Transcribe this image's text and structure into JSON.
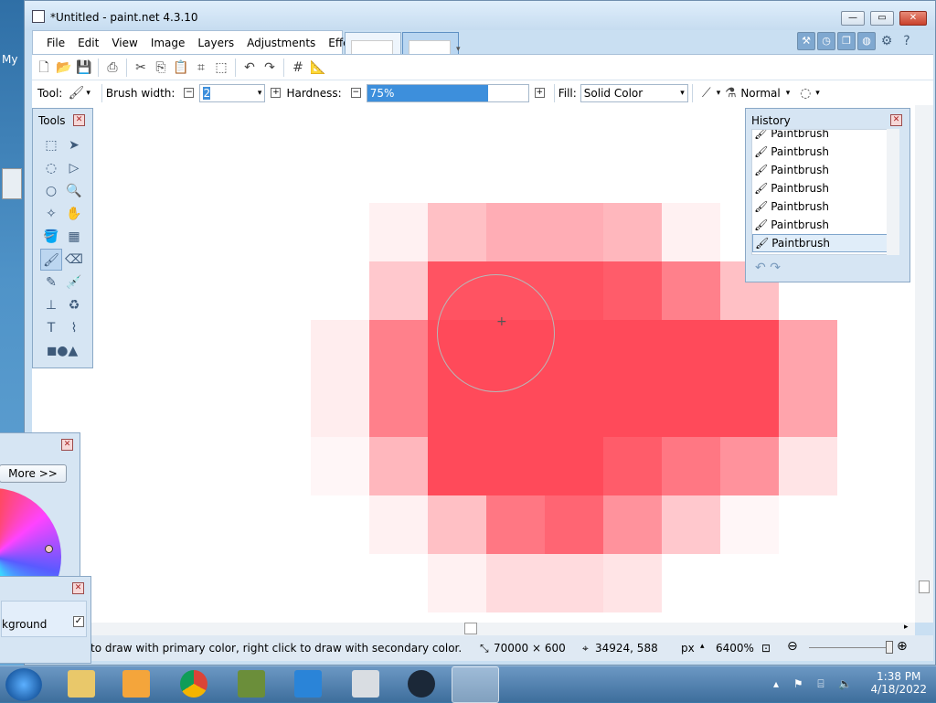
{
  "desktop": {
    "label": "My"
  },
  "window": {
    "title": "*Untitled - paint.net 4.3.10",
    "controls": {
      "minimize": "—",
      "maximize": "▭",
      "close": "✕"
    }
  },
  "menu": [
    "File",
    "Edit",
    "View",
    "Image",
    "Layers",
    "Adjustments",
    "Effects"
  ],
  "toolbar": {
    "tool_label": "Tool:",
    "brush_width_label": "Brush width:",
    "brush_width_value": "2",
    "hardness_label": "Hardness:",
    "hardness_value": "75%",
    "hardness_fraction": 0.75,
    "fill_label": "Fill:",
    "fill_value": "Solid Color",
    "blend_mode": "Normal"
  },
  "tools_panel": {
    "title": "Tools"
  },
  "history_panel": {
    "title": "History",
    "items": [
      "Paintbrush",
      "Paintbrush",
      "Paintbrush",
      "Paintbrush",
      "Paintbrush",
      "Paintbrush",
      "Paintbrush"
    ],
    "selected_index": 6
  },
  "colors_panel": {
    "more_label": "More >>"
  },
  "layers_panel": {
    "layer_name": "kground"
  },
  "statusbar": {
    "hint": "to draw with primary color, right click to draw with secondary color.",
    "image_size": "70000 × 600",
    "cursor_position": "34924, 588",
    "units": "px",
    "zoom": "6400%"
  },
  "taskbar": {
    "time": "1:38 PM",
    "date": "4/18/2022"
  },
  "colors": {
    "primary_paint": "#ff4a5a",
    "accent": "#3d8fdc"
  }
}
